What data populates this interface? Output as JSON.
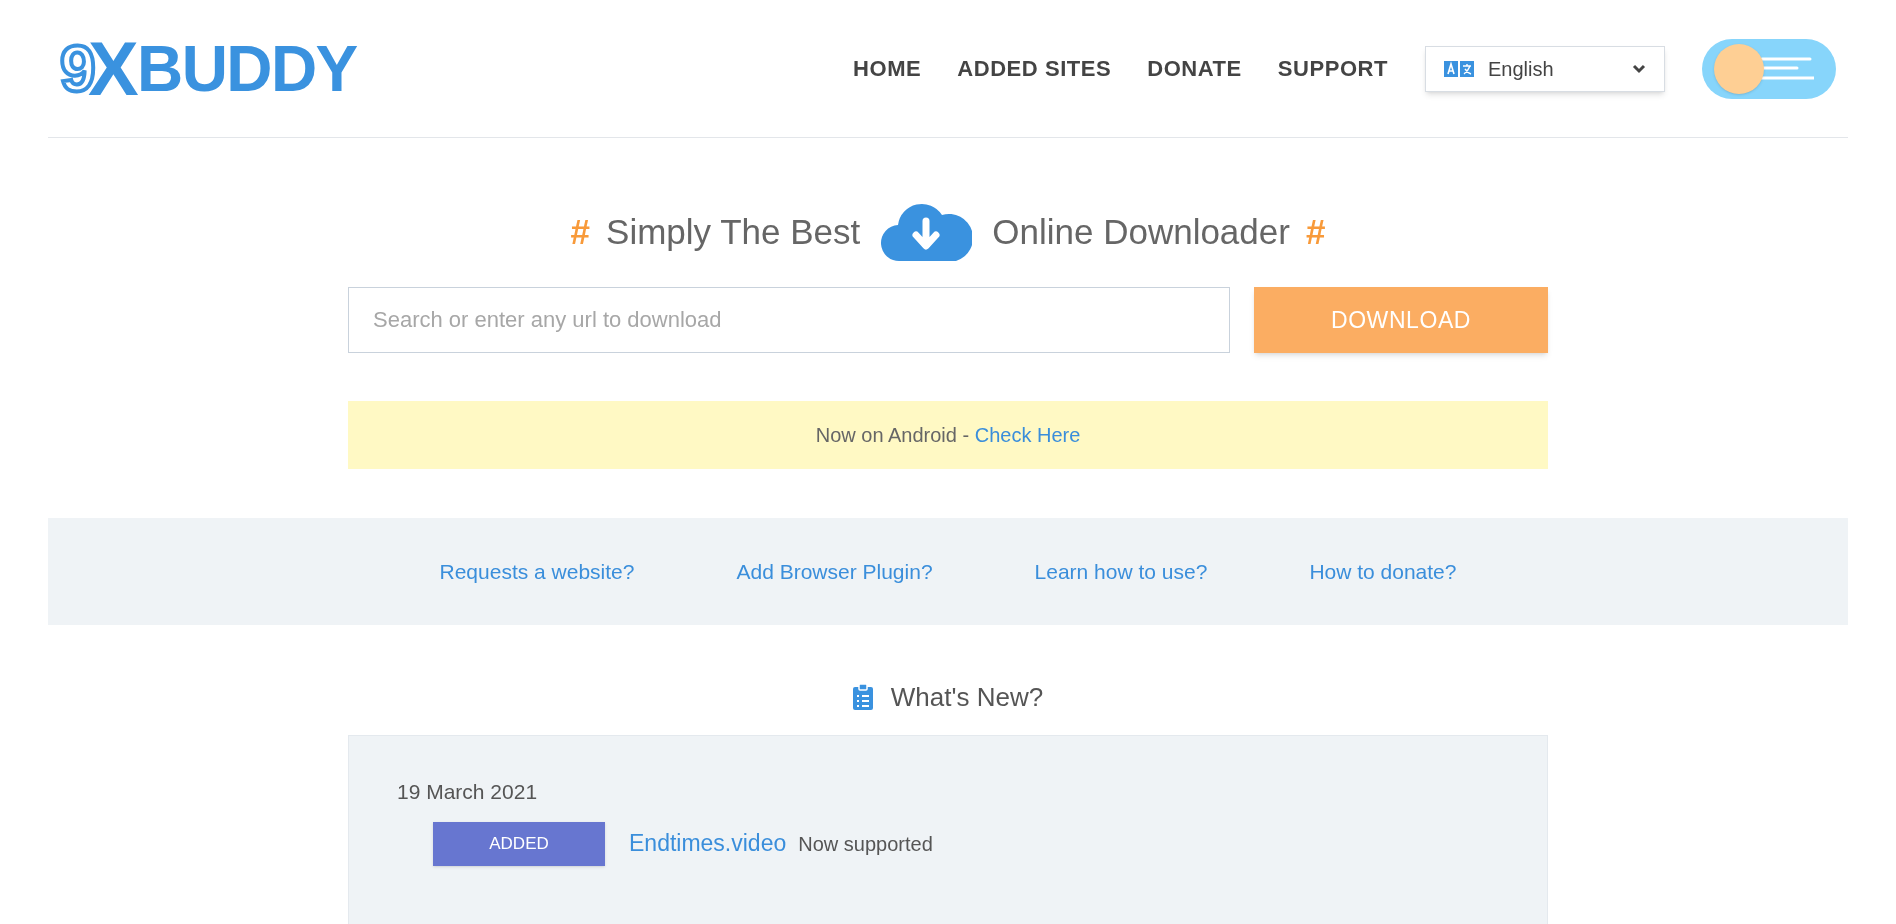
{
  "logo": {
    "parts": [
      "9",
      "X",
      "BUDDY"
    ]
  },
  "nav": [
    {
      "label": "HOME"
    },
    {
      "label": "ADDED SITES"
    },
    {
      "label": "DONATE"
    },
    {
      "label": "SUPPORT"
    }
  ],
  "language": {
    "value": "English"
  },
  "theme_toggle": {
    "on": false
  },
  "hero": {
    "hash_left": "#",
    "before": "Simply The Best",
    "after": "Online Downloader",
    "hash_right": "#"
  },
  "search": {
    "placeholder": "Search or enter any url to download",
    "button": "DOWNLOAD"
  },
  "banner": {
    "text": "Now on Android - ",
    "link": "Check Here"
  },
  "quick_links": [
    "Requests a website?",
    "Add Browser Plugin?",
    "Learn how to use?",
    "How to donate?"
  ],
  "whats_new": {
    "title": "What's New?",
    "entries": [
      {
        "date": "19 March 2021",
        "items": [
          {
            "badge": "ADDED",
            "site": "Endtimes.video",
            "note": "Now supported"
          }
        ]
      }
    ]
  }
}
